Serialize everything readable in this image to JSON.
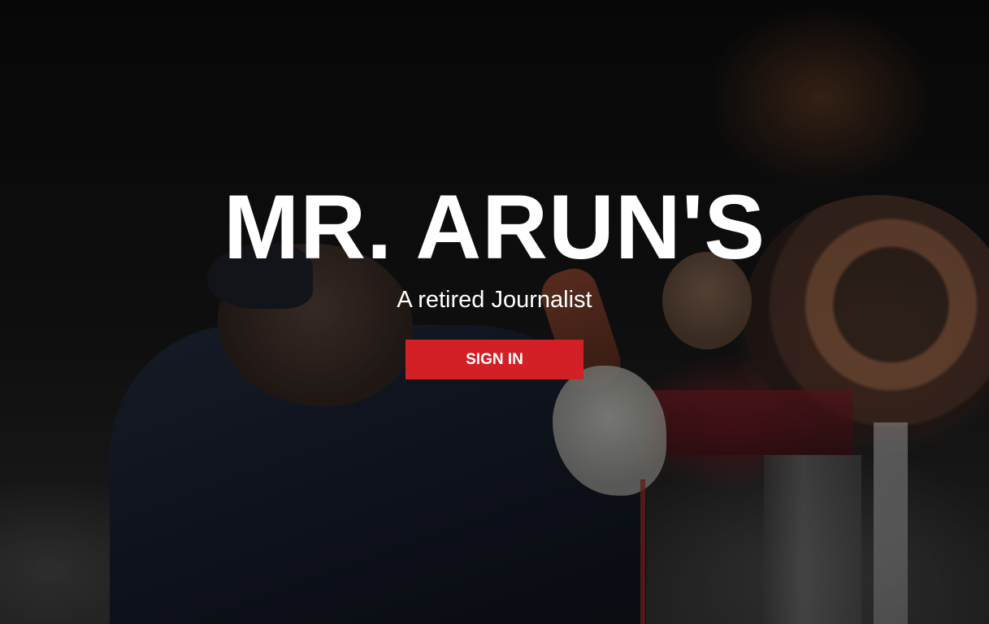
{
  "hero": {
    "title": "MR. ARUN'S",
    "subtitle": "A retired Journalist",
    "signin_label": "SIGN IN"
  },
  "colors": {
    "accent": "#d32027",
    "text": "#ffffff"
  }
}
